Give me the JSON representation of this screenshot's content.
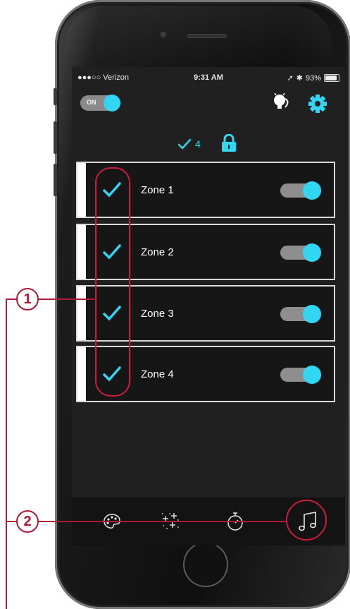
{
  "status_bar": {
    "carrier": "●●●○○ Verizon",
    "time": "9:31 AM",
    "battery": "93%"
  },
  "power_toggle": {
    "label": "ON",
    "state": "on"
  },
  "selection": {
    "count": "4"
  },
  "zones": [
    {
      "label": "Zone 1",
      "selected": true,
      "enabled": true
    },
    {
      "label": "Zone 2",
      "selected": true,
      "enabled": true
    },
    {
      "label": "Zone 3",
      "selected": true,
      "enabled": true
    },
    {
      "label": "Zone 4",
      "selected": true,
      "enabled": true
    }
  ],
  "tab_bar": [
    "palette-icon",
    "sparkle-icon",
    "timer-icon",
    "music-note-icon"
  ],
  "callouts": {
    "one": "1",
    "two": "2"
  },
  "colors": {
    "accent": "#33d6f2",
    "callout": "#b01933",
    "screen_bg": "#202021"
  }
}
